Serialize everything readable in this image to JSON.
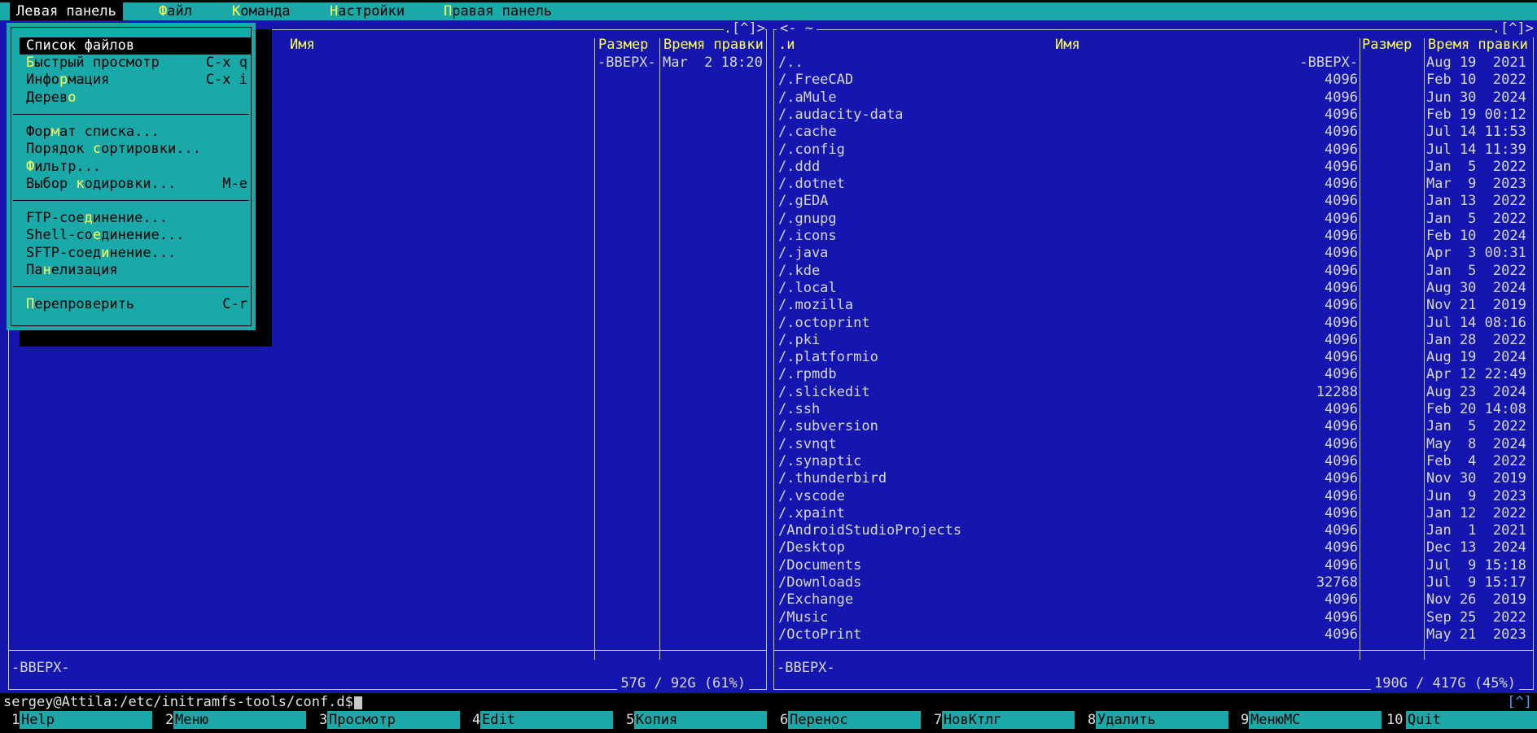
{
  "menubar": {
    "items": [
      {
        "label": "Левая панель",
        "hot": "",
        "rest": ""
      },
      {
        "label": "Файл",
        "hot": "Ф",
        "rest": "айл"
      },
      {
        "label": "Команда",
        "hot": "К",
        "rest": "оманда"
      },
      {
        "label": "Настройки",
        "hot": "Н",
        "rest": "астройки"
      },
      {
        "label": "Правая панель",
        "hot": "П",
        "rest": "равая панель"
      }
    ]
  },
  "dropdown": {
    "items": [
      {
        "pre": "Список файлов",
        "hot": "",
        "post": "",
        "key": ""
      },
      {
        "pre": "",
        "hot": "Б",
        "post": "ыстрый просмотр",
        "key": "C-x q"
      },
      {
        "pre": "Инфо",
        "hot": "р",
        "post": "мация",
        "key": "C-x i"
      },
      {
        "pre": "Дерев",
        "hot": "о",
        "post": "",
        "key": ""
      },
      {
        "pre": "Фор",
        "hot": "м",
        "post": "ат списка...",
        "key": ""
      },
      {
        "pre": "Порядок ",
        "hot": "с",
        "post": "ортировки...",
        "key": ""
      },
      {
        "pre": "",
        "hot": "Ф",
        "post": "ильтр...",
        "key": ""
      },
      {
        "pre": "Выбор ",
        "hot": "к",
        "post": "одировки...",
        "key": "M-e"
      },
      {
        "pre": "FTP-сое",
        "hot": "д",
        "post": "инение...",
        "key": ""
      },
      {
        "pre": "Shell-со",
        "hot": "е",
        "post": "динение...",
        "key": ""
      },
      {
        "pre": "SFTP-соед",
        "hot": "и",
        "post": "нение...",
        "key": ""
      },
      {
        "pre": "Па",
        "hot": "н",
        "post": "елизация",
        "key": ""
      },
      {
        "pre": "",
        "hot": "П",
        "post": "ерепроверить",
        "key": "C-r"
      }
    ]
  },
  "left_panel": {
    "topright": ".[^]>",
    "col_name": "Имя",
    "col_size": "Размер",
    "col_time": "Время правки",
    "rows": [
      {
        "name": "",
        "size": "-ВВЕРХ-",
        "time": "Mar  2 18:20"
      }
    ],
    "status": "-ВВЕРХ-",
    "disk": "57G / 92G (61%)"
  },
  "right_panel": {
    "topleft": "<- ~",
    "topright": ".[^]>",
    "col_sort": ".и",
    "col_name": "Имя",
    "col_size": "Размер",
    "col_time": "Время правки",
    "rows": [
      {
        "name": "/..",
        "size": "-ВВЕРХ-",
        "time": "Aug 19  2021"
      },
      {
        "name": "/.FreeCAD",
        "size": "4096",
        "time": "Feb 10  2022"
      },
      {
        "name": "/.aMule",
        "size": "4096",
        "time": "Jun 30  2024"
      },
      {
        "name": "/.audacity-data",
        "size": "4096",
        "time": "Feb 19 00:12"
      },
      {
        "name": "/.cache",
        "size": "4096",
        "time": "Jul 14 11:53"
      },
      {
        "name": "/.config",
        "size": "4096",
        "time": "Jul 14 11:39"
      },
      {
        "name": "/.ddd",
        "size": "4096",
        "time": "Jan  5  2022"
      },
      {
        "name": "/.dotnet",
        "size": "4096",
        "time": "Mar  9  2023"
      },
      {
        "name": "/.gEDA",
        "size": "4096",
        "time": "Jan 13  2022"
      },
      {
        "name": "/.gnupg",
        "size": "4096",
        "time": "Jan  5  2022"
      },
      {
        "name": "/.icons",
        "size": "4096",
        "time": "Feb 10  2024"
      },
      {
        "name": "/.java",
        "size": "4096",
        "time": "Apr  3 00:31"
      },
      {
        "name": "/.kde",
        "size": "4096",
        "time": "Jan  5  2022"
      },
      {
        "name": "/.local",
        "size": "4096",
        "time": "Aug 30  2024"
      },
      {
        "name": "/.mozilla",
        "size": "4096",
        "time": "Nov 21  2019"
      },
      {
        "name": "/.octoprint",
        "size": "4096",
        "time": "Jul 14 08:16"
      },
      {
        "name": "/.pki",
        "size": "4096",
        "time": "Jan 28  2022"
      },
      {
        "name": "/.platformio",
        "size": "4096",
        "time": "Aug 19  2024"
      },
      {
        "name": "/.rpmdb",
        "size": "4096",
        "time": "Apr 12 22:49"
      },
      {
        "name": "/.slickedit",
        "size": "12288",
        "time": "Aug 23  2024"
      },
      {
        "name": "/.ssh",
        "size": "4096",
        "time": "Feb 20 14:08"
      },
      {
        "name": "/.subversion",
        "size": "4096",
        "time": "Jan  5  2022"
      },
      {
        "name": "/.svnqt",
        "size": "4096",
        "time": "May  8  2024"
      },
      {
        "name": "/.synaptic",
        "size": "4096",
        "time": "Feb  4  2022"
      },
      {
        "name": "/.thunderbird",
        "size": "4096",
        "time": "Nov 30  2019"
      },
      {
        "name": "/.vscode",
        "size": "4096",
        "time": "Jun  9  2023"
      },
      {
        "name": "/.xpaint",
        "size": "4096",
        "time": "Jan 12  2022"
      },
      {
        "name": "/AndroidStudioProjects",
        "size": "4096",
        "time": "Jan  1  2021"
      },
      {
        "name": "/Desktop",
        "size": "4096",
        "time": "Dec 13  2024"
      },
      {
        "name": "/Documents",
        "size": "4096",
        "time": "Jul  9 15:18"
      },
      {
        "name": "/Downloads",
        "size": "32768",
        "time": "Jul  9 15:17"
      },
      {
        "name": "/Exchange",
        "size": "4096",
        "time": "Nov 26  2019"
      },
      {
        "name": "/Music",
        "size": "4096",
        "time": "Sep 25  2022"
      },
      {
        "name": "/OctoPrint",
        "size": "4096",
        "time": "May 21  2023"
      }
    ],
    "status": "-ВВЕРХ-",
    "disk": "190G / 417G (45%)"
  },
  "cmdline": {
    "prompt": "sergey@Attila:/etc/initramfs-tools/conf.d$",
    "right": "[^]"
  },
  "fkeys": [
    {
      "num": "1",
      "label": "Help"
    },
    {
      "num": "2",
      "label": "Меню"
    },
    {
      "num": "3",
      "label": "Просмотр"
    },
    {
      "num": "4",
      "label": "Edit"
    },
    {
      "num": "5",
      "label": "Копия"
    },
    {
      "num": "6",
      "label": "Перенос"
    },
    {
      "num": "7",
      "label": "НовКтлг"
    },
    {
      "num": "8",
      "label": "Удалить"
    },
    {
      "num": "9",
      "label": "МенюМС"
    },
    {
      "num": "10",
      "label": "Quit"
    }
  ],
  "colors": {
    "panel_bg": "#1515b0",
    "menu_bg": "#1aa9a9",
    "header_fg": "#ffff55",
    "hotkey_fg": "#ffff55"
  }
}
